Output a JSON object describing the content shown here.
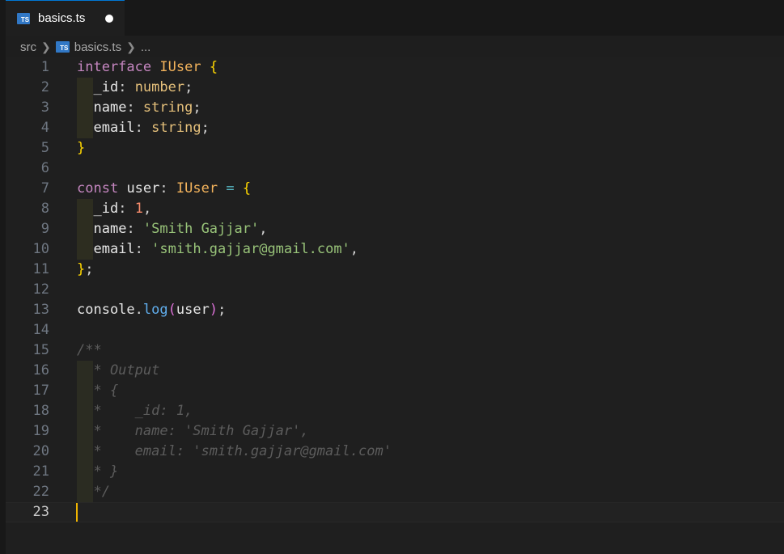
{
  "tab": {
    "label": "basics.ts",
    "icon": "typescript-file-icon",
    "modified": true
  },
  "breadcrumb": {
    "folder": "src",
    "file": "basics.ts",
    "ellipsis": "..."
  },
  "editor": {
    "current_line": 23,
    "lines": [
      {
        "n": "1",
        "tokens": [
          [
            "kw",
            "interface"
          ],
          [
            "punct",
            " "
          ],
          [
            "typeName",
            "IUser"
          ],
          [
            "punct",
            " "
          ],
          [
            "brace",
            "{"
          ]
        ]
      },
      {
        "n": "2",
        "guide": true,
        "tokens": [
          [
            "punct",
            "  "
          ],
          [
            "prop",
            "_id"
          ],
          [
            "punct",
            ": "
          ],
          [
            "type",
            "number"
          ],
          [
            "punct",
            ";"
          ]
        ]
      },
      {
        "n": "3",
        "guide": true,
        "tokens": [
          [
            "punct",
            "  "
          ],
          [
            "prop",
            "name"
          ],
          [
            "punct",
            ": "
          ],
          [
            "type",
            "string"
          ],
          [
            "punct",
            ";"
          ]
        ]
      },
      {
        "n": "4",
        "guide": true,
        "tokens": [
          [
            "punct",
            "  "
          ],
          [
            "prop",
            "email"
          ],
          [
            "punct",
            ": "
          ],
          [
            "type",
            "string"
          ],
          [
            "punct",
            ";"
          ]
        ]
      },
      {
        "n": "5",
        "tokens": [
          [
            "brace",
            "}"
          ]
        ]
      },
      {
        "n": "6",
        "tokens": []
      },
      {
        "n": "7",
        "tokens": [
          [
            "kw",
            "const"
          ],
          [
            "punct",
            " "
          ],
          [
            "var",
            "user"
          ],
          [
            "punct",
            ": "
          ],
          [
            "typeName",
            "IUser"
          ],
          [
            "punct",
            " "
          ],
          [
            "op",
            "="
          ],
          [
            "punct",
            " "
          ],
          [
            "brace",
            "{"
          ]
        ]
      },
      {
        "n": "8",
        "guide": true,
        "tokens": [
          [
            "punct",
            "  "
          ],
          [
            "prop",
            "_id"
          ],
          [
            "punct",
            ": "
          ],
          [
            "num",
            "1"
          ],
          [
            "punct",
            ","
          ]
        ]
      },
      {
        "n": "9",
        "guide": true,
        "tokens": [
          [
            "punct",
            "  "
          ],
          [
            "prop",
            "name"
          ],
          [
            "punct",
            ": "
          ],
          [
            "str",
            "'Smith Gajjar'"
          ],
          [
            "punct",
            ","
          ]
        ]
      },
      {
        "n": "10",
        "guide": true,
        "tokens": [
          [
            "punct",
            "  "
          ],
          [
            "prop",
            "email"
          ],
          [
            "punct",
            ": "
          ],
          [
            "str",
            "'smith.gajjar@gmail.com'"
          ],
          [
            "punct",
            ","
          ]
        ]
      },
      {
        "n": "11",
        "tokens": [
          [
            "brace",
            "}"
          ],
          [
            "punct",
            ";"
          ]
        ]
      },
      {
        "n": "12",
        "tokens": []
      },
      {
        "n": "13",
        "tokens": [
          [
            "var",
            "console"
          ],
          [
            "punct",
            "."
          ],
          [
            "fn",
            "log"
          ],
          [
            "brace2",
            "("
          ],
          [
            "var",
            "user"
          ],
          [
            "brace2",
            ")"
          ],
          [
            "punct",
            ";"
          ]
        ]
      },
      {
        "n": "14",
        "tokens": []
      },
      {
        "n": "15",
        "tokens": [
          [
            "cmt",
            "/**"
          ]
        ]
      },
      {
        "n": "16",
        "guide": "comment",
        "tokens": [
          [
            "cmt",
            "  * Output"
          ]
        ]
      },
      {
        "n": "17",
        "guide": "comment",
        "tokens": [
          [
            "cmt",
            "  * {"
          ]
        ]
      },
      {
        "n": "18",
        "guide": "comment",
        "tokens": [
          [
            "cmt",
            "  *    _id: 1,"
          ]
        ]
      },
      {
        "n": "19",
        "guide": "comment",
        "tokens": [
          [
            "cmt",
            "  *    name: 'Smith Gajjar',"
          ]
        ]
      },
      {
        "n": "20",
        "guide": "comment",
        "tokens": [
          [
            "cmt",
            "  *    email: 'smith.gajjar@gmail.com'"
          ]
        ]
      },
      {
        "n": "21",
        "guide": "comment",
        "tokens": [
          [
            "cmt",
            "  * }"
          ]
        ]
      },
      {
        "n": "22",
        "guide": "comment",
        "tokens": [
          [
            "cmt",
            "  */"
          ]
        ]
      },
      {
        "n": "23",
        "tokens": []
      }
    ]
  }
}
